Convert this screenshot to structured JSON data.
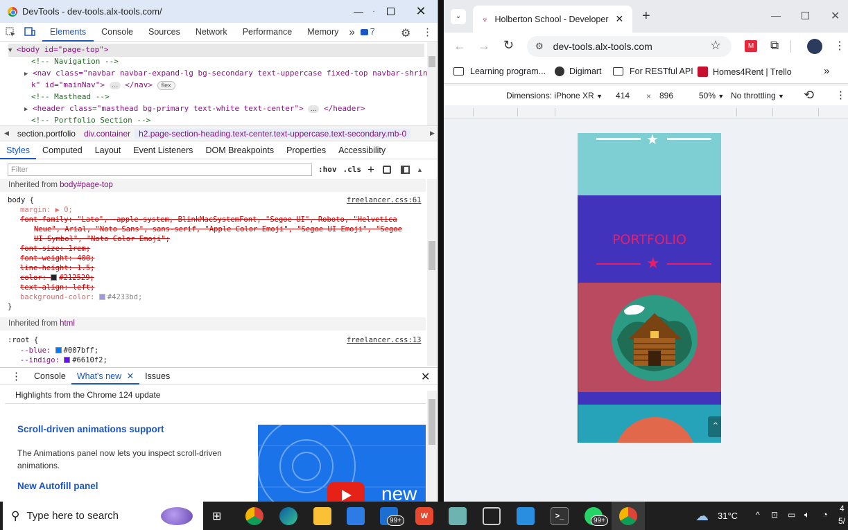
{
  "devtools": {
    "window_title": "DevTools - dev-tools.alx-tools.com/",
    "main_tabs": [
      "Elements",
      "Console",
      "Sources",
      "Network",
      "Performance",
      "Memory"
    ],
    "more_tabs": "»",
    "issues_count": "7",
    "elements": {
      "body_open": "<body id=\"page-top\">",
      "comment_navigation": "<!-- Navigation -->",
      "nav_line_1": "<nav class=\"navbar navbar-expand-lg bg-secondary text-uppercase fixed-top navbar-shrin",
      "nav_line_2": "k\" id=\"mainNav\">",
      "nav_close": "</nav>",
      "flex_badge": "flex",
      "ellipsis": "…",
      "comment_masthead": "<!-- Masthead -->",
      "header_line": "<header class=\"masthead bg-primary text-white text-center\">",
      "header_close": "</header>",
      "comment_portfolio": "<!-- Portfolio Section -->"
    },
    "breadcrumbs": [
      "section.portfolio",
      "div.container",
      "h2.page-section-heading.text-center.text-uppercase.text-secondary.mb-0"
    ],
    "sub_tabs": [
      "Styles",
      "Computed",
      "Layout",
      "Event Listeners",
      "DOM Breakpoints",
      "Properties",
      "Accessibility"
    ],
    "filter_placeholder": "Filter",
    "hov": ":hov",
    "cls": ".cls",
    "styles": {
      "inherited_from_1": "Inherited from",
      "inherited_target_1": "body#page-top",
      "body_selector": "body {",
      "body_source": "freelancer.css:61",
      "margin": "margin: ▶ 0;",
      "font_family_1": "font-family: \"Lato\", -apple-system, BlinkMacSystemFont, \"Segoe UI\", Roboto, \"Helvetica",
      "font_family_2": "Neue\", Arial, \"Noto Sans\", sans-serif, \"Apple Color Emoji\", \"Segoe UI Emoji\", \"Segoe",
      "font_family_3": "UI Symbol\", \"Noto Color Emoji\";",
      "font_size": "font-size: 1rem;",
      "font_weight": "font-weight: 400;",
      "line_height": "line-height: 1.5;",
      "color_prop": "color:",
      "color_val": "#212529;",
      "text_align": "text-align: left;",
      "bg_prop": "background-color:",
      "bg_val": "#4233bd;",
      "close_brace": "}",
      "inherited_from_2": "Inherited from",
      "inherited_target_2": "html",
      "root_selector": ":root {",
      "root_source": "freelancer.css:13",
      "blue_prop": "--blue:",
      "blue_val": "#007bff;",
      "indigo_prop": "--indigo:",
      "indigo_val": "#6610f2;"
    },
    "drawer_tabs": [
      "Console",
      "What's new",
      "Issues"
    ],
    "whatsnew": {
      "highlights": "Highlights from the Chrome 124 update",
      "h1": "Scroll-driven animations support",
      "p1": "The Animations panel now lets you inspect scroll-driven animations.",
      "h2": "New Autofill panel",
      "video_text": "new"
    }
  },
  "browser": {
    "tab_title": "Holberton School - Developer t",
    "url": "dev-tools.alx-tools.com",
    "bookmarks": [
      "Learning program...",
      "Digimart",
      "For RESTful API",
      "Homes4Rent | Trello"
    ],
    "device": {
      "dimensions_label": "Dimensions: iPhone XR",
      "width": "414",
      "times": "×",
      "height": "896",
      "zoom": "50%",
      "throttle": "No throttling"
    },
    "page": {
      "portfolio_heading": "PORTFOLIO",
      "heading_color": "#e91e63",
      "bg_color": "#4233bd"
    }
  },
  "taskbar": {
    "search_placeholder": "Type here to search",
    "badge_1": "99+",
    "badge_2": "99+",
    "weather": "31°C",
    "clock_1": "4",
    "clock_2": "5/"
  }
}
